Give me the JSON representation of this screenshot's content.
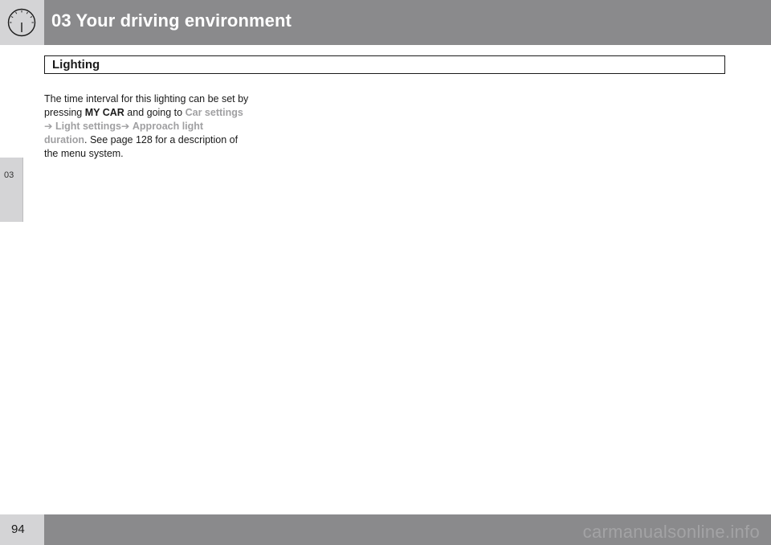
{
  "header": {
    "title": "03 Your driving environment",
    "icon": "speedometer-icon"
  },
  "side_tab": {
    "label": "03"
  },
  "section": {
    "title": "Lighting"
  },
  "body": {
    "line1": "The time interval for this lighting can be set by",
    "line2_prefix": "pressing ",
    "button_name": "MY CAR",
    "line2_middle": " and going to ",
    "menu_car_settings": "Car settings",
    "arrow1": "➔",
    "menu_light_settings": "Light settings",
    "arrow2": "➔",
    "menu_approach_light": "Approach light",
    "menu_duration": "duration",
    "line4_suffix": ". See page 128 for a description of",
    "line5": "the menu system."
  },
  "footer": {
    "page_number": "94",
    "watermark": "carmanualsonline.info"
  },
  "colors": {
    "header_bar": "#8a8a8c",
    "light_box": "#d4d4d6",
    "menu_text": "#a0a0a2"
  }
}
